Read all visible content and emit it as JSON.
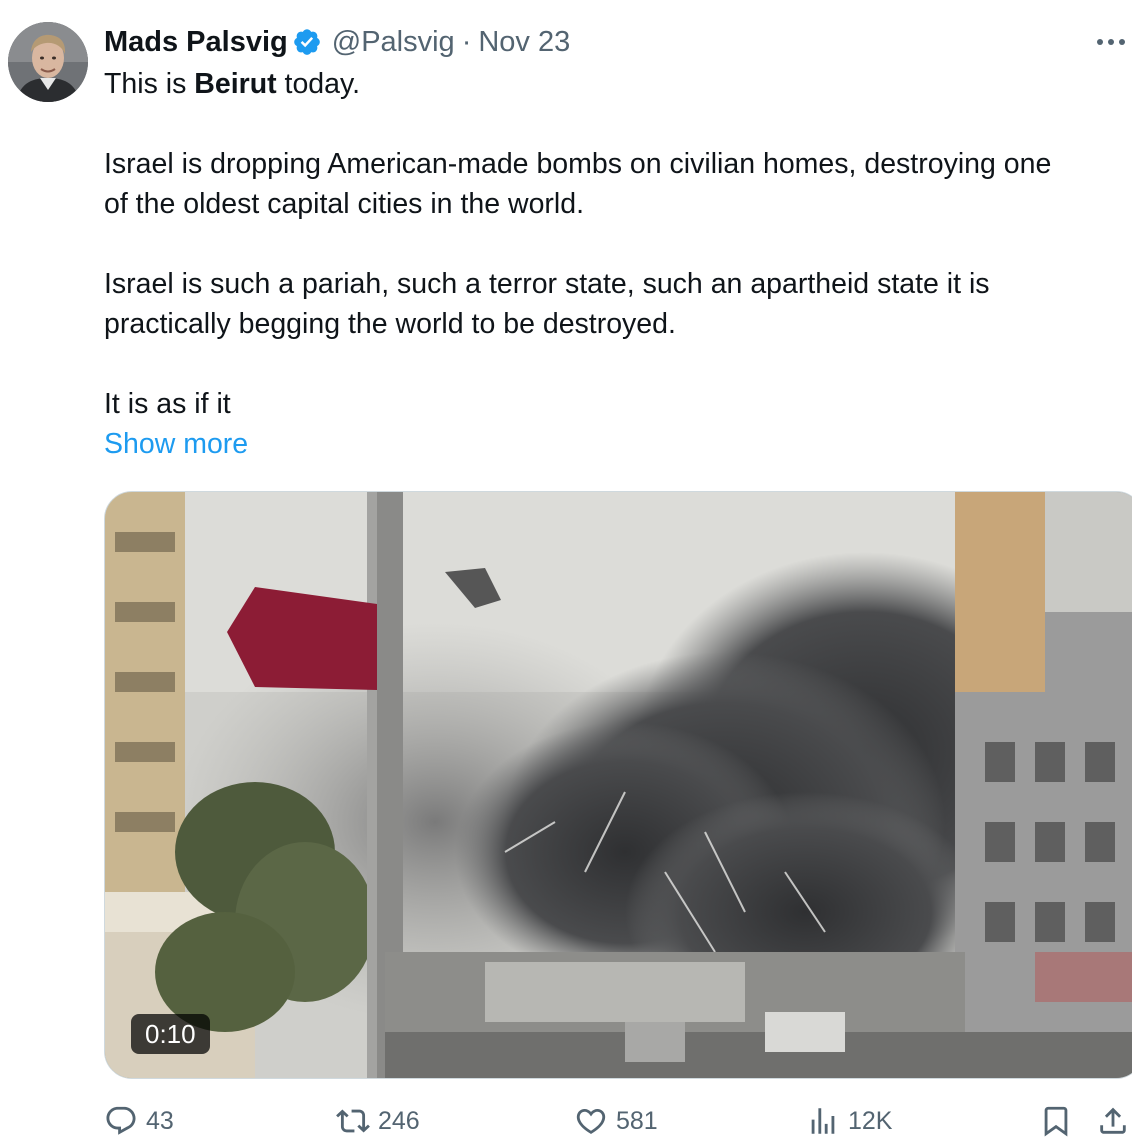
{
  "post": {
    "author_name": "Mads Palsvig",
    "author_handle": "@Palsvig",
    "separator": "·",
    "date": "Nov 23",
    "text": {
      "line1_before": "This is ",
      "line1_bold": "Beirut",
      "line1_after": " today.",
      "para2_line1": "Israel is dropping American-made bombs on civilian homes, destroying one",
      "para2_line2": "of the oldest capital cities in the world.",
      "para3_line1": "Israel is such a pariah, such a terror state, such an apartheid state it is",
      "para3_line2": "practically begging the world to be destroyed.",
      "para4_line1": "It is as if it"
    },
    "show_more_label": "Show more",
    "video": {
      "duration": "0:10"
    },
    "metrics": {
      "replies": "43",
      "reposts": "246",
      "likes": "581",
      "views": "12K"
    }
  },
  "icons": {
    "verified": "verified-badge-icon",
    "more": "more-options-icon",
    "reply": "reply-icon",
    "repost": "repost-icon",
    "like": "heart-icon",
    "views": "views-chart-icon",
    "bookmark": "bookmark-icon",
    "share": "share-icon"
  },
  "colors": {
    "text": "#0f1419",
    "secondary": "#536471",
    "link": "#1d9bf0",
    "verified": "#1d9bf0"
  }
}
